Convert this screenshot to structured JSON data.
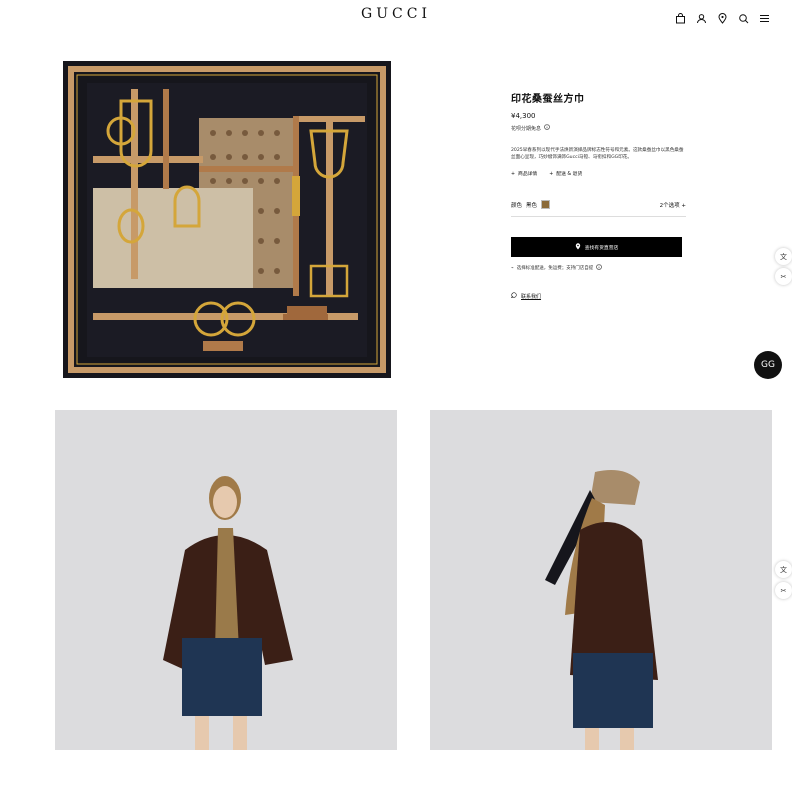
{
  "header": {
    "logo": "GUCCI",
    "icons": [
      "bag-icon",
      "user-icon",
      "location-icon",
      "search-icon",
      "menu-icon"
    ]
  },
  "product": {
    "title": "印花桑蚕丝方巾",
    "price": "¥4,300",
    "installment": "花呗分期免息",
    "description": "2025早春系列以现代手法焕新演绎品牌标志性符号和元素。这款桑蚕丝巾以黑色桑蚕丝面心呈现，巧妙缀饰满饰Gucci马镫、马衔扣和GG印花。",
    "links": [
      "商品详情",
      "配送 & 退货"
    ],
    "color_label": "颜色",
    "color_value": "黑色",
    "options": "2个选项",
    "store_button": "查找有货直营店",
    "shipping": "选择标准配送，免运费；支持门店自提",
    "contact": "联系我们"
  },
  "colors": {
    "scarf_dark": "#16161c",
    "scarf_gold": "#d4a63a",
    "scarf_tan": "#c79a68",
    "button_bg": "#000000",
    "jacket": "#3b1f16",
    "denim": "#1f3553"
  }
}
